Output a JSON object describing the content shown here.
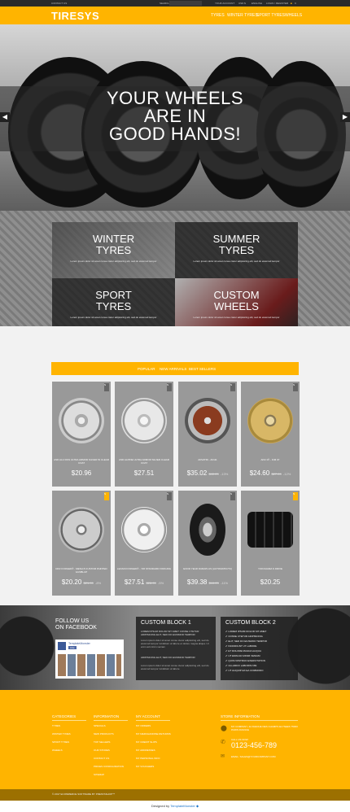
{
  "topbar": {
    "contact_us": "CONTACT US",
    "search_label": "SEARCH",
    "your_account": "YOUR ACCOUNT",
    "currency": "USD $",
    "language": "ENGLISH",
    "cart": "CART",
    "username": "LOGIN / REGISTER",
    "cart_count": "0"
  },
  "header": {
    "logo": "TIRESYS",
    "nav": [
      "TYRES",
      "WINTER TYRES",
      "SPORT TYRES",
      "WHEELS"
    ]
  },
  "hero": {
    "line1": "YOUR WHEELS",
    "line2": "ARE IN",
    "line3": "GOOD HANDS!"
  },
  "categories": [
    {
      "title1": "WINTER",
      "title2": "TYRES",
      "desc": "Lorem ipsum dolor sit amet conse ctetur adipisicing elit, sed do eiusmod tempor"
    },
    {
      "title1": "SUMMER",
      "title2": "TYRES",
      "desc": "Lorem ipsum dolor sit amet conse ctetur adipisicing elit, sed do eiusmod tempor"
    },
    {
      "title1": "SPORT",
      "title2": "TYRES",
      "desc": "Lorem ipsum dolor sit amet conse ctetur adipisicing elit, sed do eiusmod tempor"
    },
    {
      "title1": "CUSTOM",
      "title2": "WHEELS",
      "desc": "Lorem ipsum dolor sit amet conse ctetur adipisicing elit, sed do eiusmod tempor"
    }
  ],
  "tabs": [
    "POPULAR",
    "NEW ARRIVALS",
    "BEST SELLERS"
  ],
  "products": [
    {
      "name": "ASD ALU DKN ULTRA ARMOR SILVER W CLEAR COAT",
      "price": "$20.96",
      "old": "",
      "pct": "",
      "badge": "N",
      "badge_yellow": false
    },
    {
      "name": "ASD ALPINE ULTRA ARMOR SILVER CLEAR COAT",
      "price": "$27.51",
      "old": "",
      "pct": "",
      "badge": "N",
      "badge_yellow": false
    },
    {
      "name": "ADVATID - AF111",
      "price": "$35.02",
      "old": "$40.29",
      "pct": "-13%",
      "badge": "N",
      "badge_yellow": false
    },
    {
      "name": "ADV.1® - ICM 07",
      "price": "$24.60",
      "old": "$27.99",
      "pct": "-12%",
      "badge": "N",
      "badge_yellow": false
    },
    {
      "name": "DKR FORGED® - MESH 8 CUSTOM PAINTED GUNBLUP",
      "price": "$20.20",
      "old": "$21.99",
      "pct": "-8%",
      "badge": "N",
      "badge_yellow": true
    },
    {
      "name": "LEXANI FORGED® - 726 STANDARD FORGING",
      "price": "$27.51",
      "old": "$28.99",
      "pct": "-5%",
      "badge": "N",
      "badge_yellow": false
    },
    {
      "name": "GOOD YEAR DURAPLUS (AUTOMATIC/TC)",
      "price": "$39.38",
      "old": "$44.29",
      "pct": "-11%",
      "badge": "N",
      "badge_yellow": false
    },
    {
      "name": "YOKOHAMA S DRIVE",
      "price": "$20.25",
      "old": "",
      "pct": "",
      "badge": "N",
      "badge_yellow": true
    }
  ],
  "social": {
    "follow1": "FOLLOW US",
    "follow2": "ON FACEBOOK",
    "fb_page": "TemplateMonster",
    "fb_like": "Like",
    "custom1_title": "CUSTOM BLOCK 1",
    "custom1_text1": "LOREM IPSUM DOLOR SIT AMET CONSE CTETUR ADIPISICING ELIT, SED DO EIUSMOD TEMPOR",
    "custom1_text2": "Lorem ipsum dolor sit amet conse ctetur adipisicing elit, sed do eiusmod tempor incididunt ut labore et dolore magna aliqua. Ut enim ad minim veniam",
    "custom1_text3": "ADIPISICING ELIT, SED DO EIUSMOD TEMPOR",
    "custom1_text4": "Lorem ipsum dolor sit amet conse ctetur adipisicing elit, sed do eiusmod tempor incididunt ut labore",
    "custom2_title": "CUSTOM BLOCK 2",
    "custom2_items": [
      "LOREM IPSUM DOLOR SIT AMET",
      "CONSE CTETUR ADIPISICING",
      "ELIT, SED DO EIUSMOD TEMPOR",
      "INCIDIDUNT UT LABORE",
      "ET DOLORE MAGNA ALIQUA",
      "UT ENIM AD MINIM VENIAM",
      "QUIS NOSTRUD EXERCITATION",
      "ULLAMCO LABORIS NISI",
      "UT ALIQUIP EX EA COMMODO"
    ]
  },
  "footer": {
    "col1_title": "CATEGORIES",
    "col1_items": [
      "TYRES",
      "WINTER TYRES",
      "SPORT TYRES",
      "WHEELS"
    ],
    "col2_title": "INFORMATION",
    "col2_items": [
      "SPECIALS",
      "NEW PRODUCTS",
      "TOP SELLERS",
      "OUR STORES",
      "CONTACT US",
      "PRICES CONFIGURATION",
      "SITEMAP"
    ],
    "col3_title": "MY ACCOUNT",
    "col3_items": [
      "MY ORDERS",
      "MY MERCHANDISE RETURNS",
      "MY CREDIT SLIPS",
      "MY ADDRESSES",
      "MY PERSONAL INFO",
      "MY VOUCHERS"
    ],
    "col4_title": "STORE INFORMATION",
    "address": "MY COMPANY, 42 AVENUE DES CHAMPS ELYSEES 75000 PARIS FRANCE",
    "call_label": "CALL US NOW:",
    "phone": "0123-456-789",
    "email_label": "EMAIL: SALES@YOURCOMPANY.COM",
    "copyright": "© 2017 ECOMMERCE SOFTWARE BY PRESTASHOP™",
    "designed_by": "Designed by",
    "designer": "TemplateMonster"
  }
}
